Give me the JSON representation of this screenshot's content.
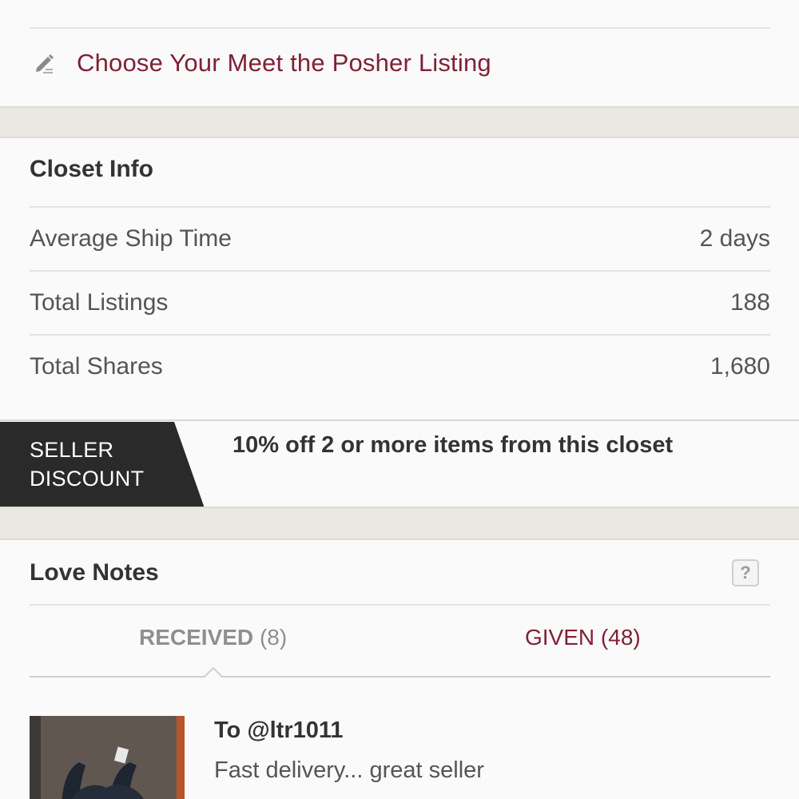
{
  "meet_the_posher": {
    "label": "Choose Your Meet the Posher Listing",
    "icon": "pencil-icon",
    "accent_color": "#7f2136"
  },
  "closet_info": {
    "title": "Closet Info",
    "rows": [
      {
        "label": "Average Ship Time",
        "value": "2 days"
      },
      {
        "label": "Total Listings",
        "value": "188"
      },
      {
        "label": "Total Shares",
        "value": "1,680"
      }
    ]
  },
  "seller_discount": {
    "badge_line1": "SELLER",
    "badge_line2": "DISCOUNT",
    "text": "10% off 2 or more items from this closet"
  },
  "love_notes": {
    "title": "Love Notes",
    "help_icon": "?",
    "tabs": [
      {
        "name": "RECEIVED",
        "count": "(8)",
        "active": true
      },
      {
        "name": "GIVEN",
        "count": "(48)",
        "active": false
      }
    ],
    "items": [
      {
        "to": "To @ltr1011",
        "text": "Fast delivery... great seller"
      }
    ]
  }
}
